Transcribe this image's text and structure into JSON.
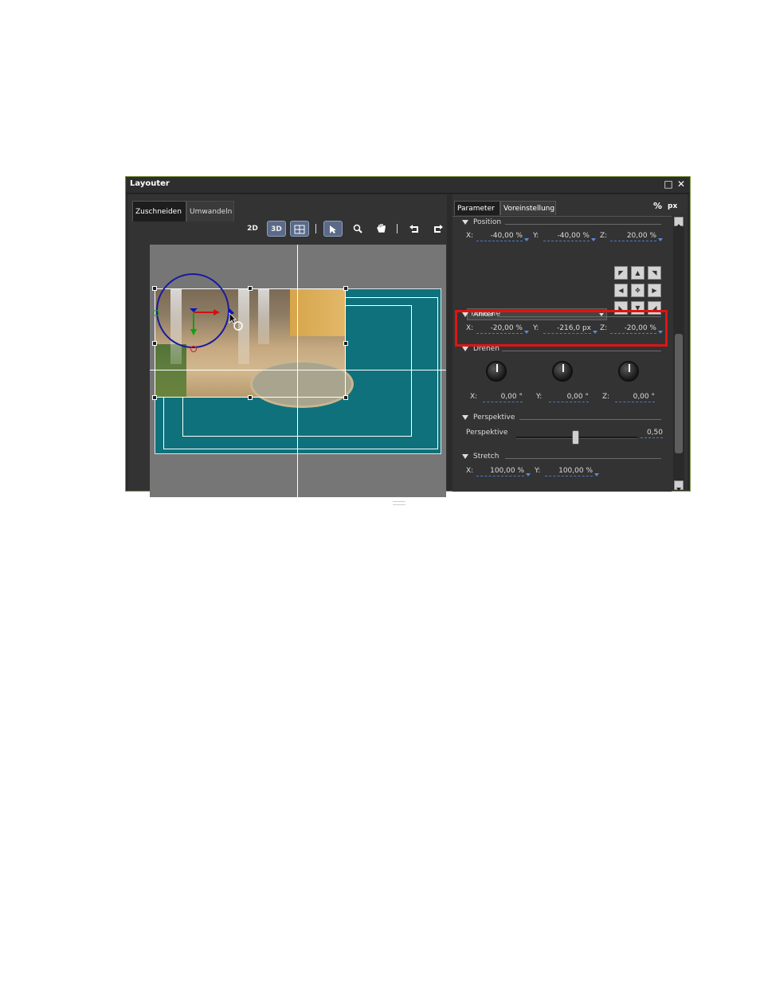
{
  "window": {
    "title": "Layouter",
    "maximize_icon": "maximize-icon",
    "close_icon": "close-icon"
  },
  "left": {
    "tabs": [
      {
        "label": "Zuschneiden",
        "active": true
      },
      {
        "label": "Umwandeln",
        "active": false
      }
    ],
    "toolbar": {
      "btn_2d": "2D",
      "btn_3d": "3D",
      "icons": [
        "display-grid-icon",
        "select-arrow-icon",
        "zoom-icon",
        "hand-icon",
        "undo-icon",
        "redo-icon"
      ]
    }
  },
  "right": {
    "tabs": [
      {
        "label": "Parameter",
        "active": true
      },
      {
        "label": "Voreinstellung",
        "active": false
      }
    ],
    "unit_percent": "%",
    "unit_px": "px",
    "sections": {
      "position": {
        "title": "Position",
        "x_label": "X:",
        "x_value": "-40,00 %",
        "y_label": "Y:",
        "y_value": "-40,00 %",
        "z_label": "Z:",
        "z_value": "20,00 %",
        "preset": "Titlesafe"
      },
      "anker": {
        "title": "Anker",
        "x_label": "X:",
        "x_value": "-20,00 %",
        "y_label": "Y:",
        "y_value": "-216,0 px",
        "z_label": "Z:",
        "z_value": "-20,00 %"
      },
      "drehen": {
        "title": "Drehen",
        "x_label": "X:",
        "x_value": "0,00 °",
        "y_label": "Y:",
        "y_value": "0,00 °",
        "z_label": "Z:",
        "z_value": "0,00 °"
      },
      "perspektive": {
        "title": "Perspektive",
        "label": "Perspektive",
        "value": "0,50"
      },
      "stretch": {
        "title": "Stretch",
        "x_label": "X:",
        "x_value": "100,00 %",
        "y_label": "Y:",
        "y_value": "100,00 %"
      }
    }
  },
  "colors": {
    "highlight": "#e01414",
    "canvas_bg": "#0f717b",
    "accent_link": "#4a7ac8"
  }
}
